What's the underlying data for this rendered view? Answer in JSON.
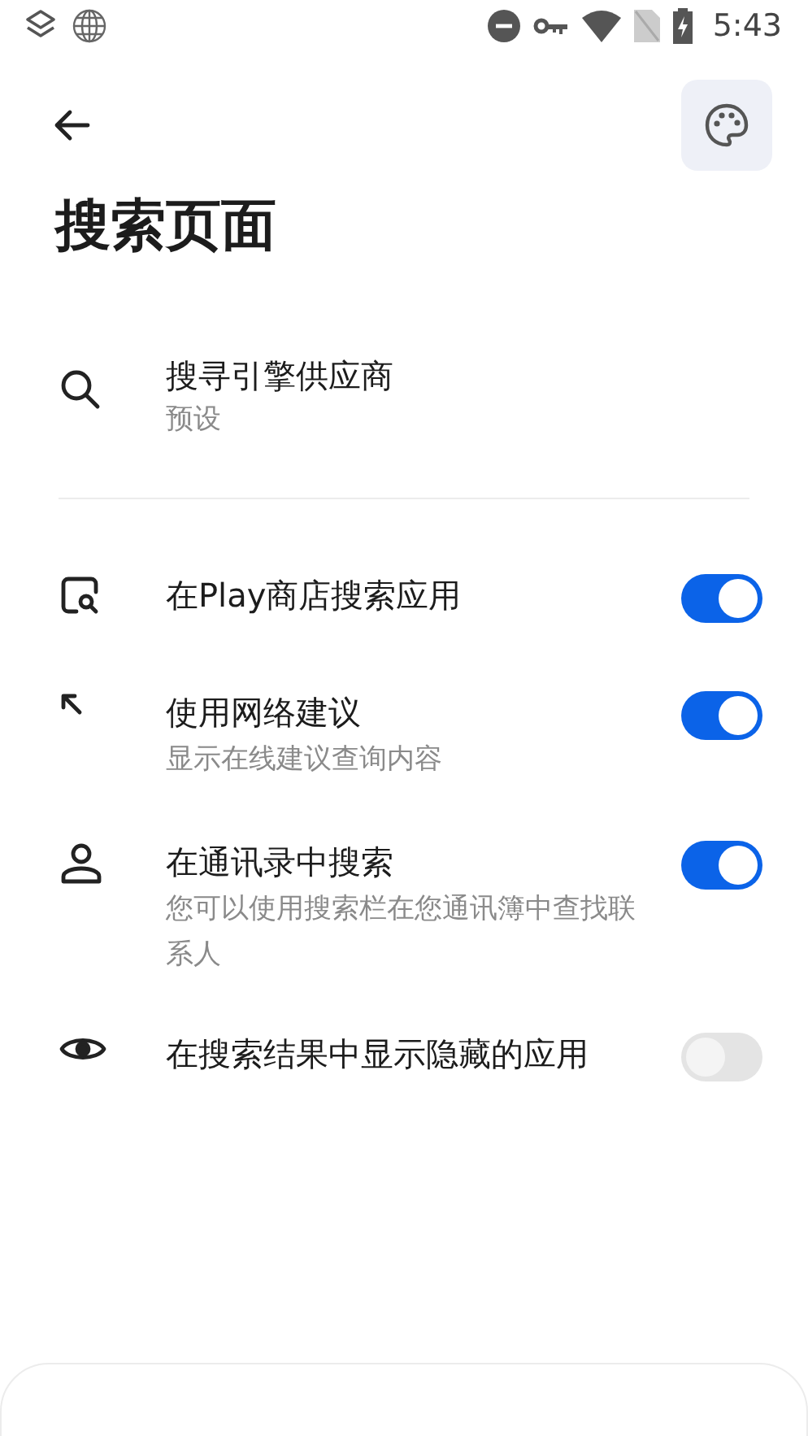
{
  "status_bar": {
    "time": "5:43"
  },
  "header": {
    "title": "搜索页面"
  },
  "provider": {
    "title": "搜寻引擎供应商",
    "subtitle": "预设"
  },
  "settings": [
    {
      "kind": "play",
      "title": "在Play商店搜索应用",
      "on": true
    },
    {
      "kind": "web",
      "title": "使用网络建议",
      "subtitle": "显示在线建议查询内容",
      "on": true
    },
    {
      "kind": "contacts",
      "title": "在通讯录中搜索",
      "subtitle": "您可以使用搜索栏在您通讯簿中查找联系人",
      "on": true
    },
    {
      "kind": "hidden",
      "title": "在搜索结果中显示隐藏的应用",
      "on": false
    }
  ]
}
